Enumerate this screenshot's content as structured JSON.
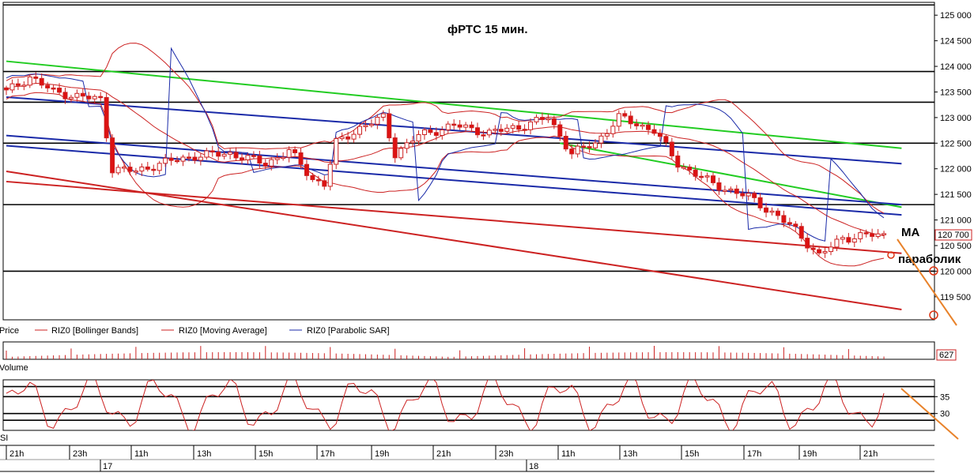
{
  "chart_data": {
    "type": "candlestick",
    "title": "фРТС  15 мин.",
    "price_axis": {
      "ylim": [
        119050,
        125250
      ],
      "ticks": [
        119500,
        120000,
        120500,
        121000,
        121500,
        122000,
        122500,
        123000,
        123500,
        124000,
        124500,
        125000
      ],
      "tick_labels": [
        "119 500",
        "120 000",
        "120 500",
        "121 000",
        "121 500",
        "122 000",
        "122 500",
        "123 000",
        "123 500",
        "124 000",
        "124 500",
        "125 000"
      ],
      "last_price": 120700,
      "last_price_label": "120 700"
    },
    "time_axis": {
      "hour_labels": [
        "21h",
        "23h",
        "11h",
        "13h",
        "15h",
        "17h",
        "19h",
        "21h",
        "23h",
        "11h",
        "13h",
        "15h",
        "17h",
        "19h",
        "21h"
      ],
      "day_labels": [
        "17",
        "18"
      ]
    },
    "legend": [
      "Price",
      "RIZ0 [Bollinger Bands]",
      "RIZ0 [Moving Average]",
      "RIZ0 [Parabolic SAR]"
    ],
    "annotations": [
      "MA",
      "параболик"
    ],
    "horizontal_levels": [
      125200,
      123900,
      123300,
      122500,
      121300,
      120000
    ],
    "trendlines": [
      {
        "color": "#22cc22",
        "from": {
          "i": 0,
          "y": 124100
        },
        "to": {
          "i": 152,
          "y": 122400
        }
      },
      {
        "color": "#22cc22",
        "from": {
          "i": 94,
          "y": 122500
        },
        "to": {
          "i": 152,
          "y": 121250
        }
      },
      {
        "color": "#1a2aa8",
        "from": {
          "i": 0,
          "y": 123400
        },
        "to": {
          "i": 152,
          "y": 122100
        }
      },
      {
        "color": "#1a2aa8",
        "from": {
          "i": 0,
          "y": 122650
        },
        "to": {
          "i": 152,
          "y": 121300
        }
      },
      {
        "color": "#1a2aa8",
        "from": {
          "i": 0,
          "y": 122450
        },
        "to": {
          "i": 152,
          "y": 121100
        }
      },
      {
        "color": "#cc2222",
        "from": {
          "i": 0,
          "y": 121950
        },
        "to": {
          "i": 152,
          "y": 119250
        }
      },
      {
        "color": "#cc2222",
        "from": {
          "i": 0,
          "y": 121750
        },
        "to": {
          "i": 152,
          "y": 120350
        }
      }
    ],
    "anchors": [
      [
        0,
        123500
      ],
      [
        4,
        123800
      ],
      [
        8,
        123500
      ],
      [
        13,
        123400
      ],
      [
        16,
        123350
      ],
      [
        18,
        122000
      ],
      [
        22,
        121950
      ],
      [
        26,
        122100
      ],
      [
        32,
        122250
      ],
      [
        38,
        122300
      ],
      [
        44,
        122100
      ],
      [
        48,
        122350
      ],
      [
        52,
        121800
      ],
      [
        54,
        121700
      ],
      [
        56,
        122500
      ],
      [
        60,
        122800
      ],
      [
        64,
        123000
      ],
      [
        66,
        122300
      ],
      [
        70,
        122650
      ],
      [
        76,
        122850
      ],
      [
        82,
        122700
      ],
      [
        88,
        122850
      ],
      [
        92,
        123000
      ],
      [
        96,
        122300
      ],
      [
        100,
        122500
      ],
      [
        104,
        123000
      ],
      [
        110,
        122750
      ],
      [
        114,
        122100
      ],
      [
        120,
        121700
      ],
      [
        126,
        121450
      ],
      [
        130,
        121150
      ],
      [
        134,
        120800
      ],
      [
        138,
        120300
      ],
      [
        142,
        120650
      ],
      [
        146,
        120700
      ],
      [
        149,
        120700
      ]
    ],
    "rsi_axis": {
      "ticks": [
        30,
        35
      ],
      "tick_labels": [
        "30",
        "35"
      ],
      "levels": [
        38,
        35,
        30,
        28
      ]
    },
    "volume_label": "627",
    "panel_labels": {
      "volume": "Volume",
      "rsi": "RSI"
    }
  }
}
